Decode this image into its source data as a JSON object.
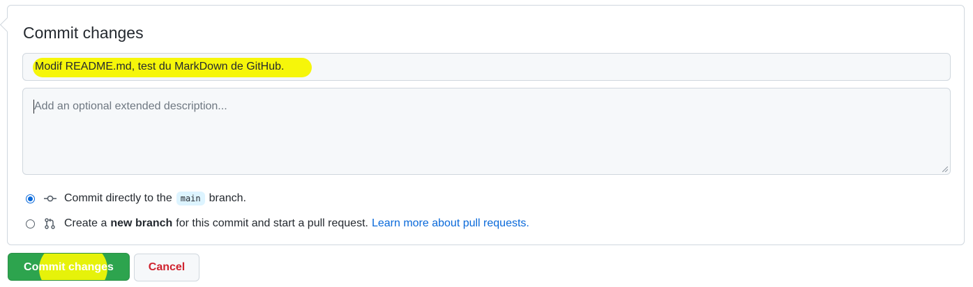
{
  "commit": {
    "title": "Commit changes",
    "summary_value": "Modif README.md, test du MarkDown de GitHub.",
    "description_placeholder": "Add an optional extended description...",
    "options": {
      "direct": {
        "checked": true,
        "prefix": "Commit directly to the",
        "branch": "main",
        "suffix": "branch.",
        "icon": "git-commit-icon"
      },
      "new_branch": {
        "checked": false,
        "prefix": "Create a",
        "bold": "new branch",
        "suffix": "for this commit and start a pull request.",
        "link": "Learn more about pull requests.",
        "icon": "git-pull-request-icon"
      }
    }
  },
  "buttons": {
    "commit_label": "Commit changes",
    "cancel_label": "Cancel"
  },
  "colors": {
    "primary": "#2da44e",
    "danger": "#cf222e",
    "link": "#0969da",
    "highlight": "#f6f60a"
  }
}
